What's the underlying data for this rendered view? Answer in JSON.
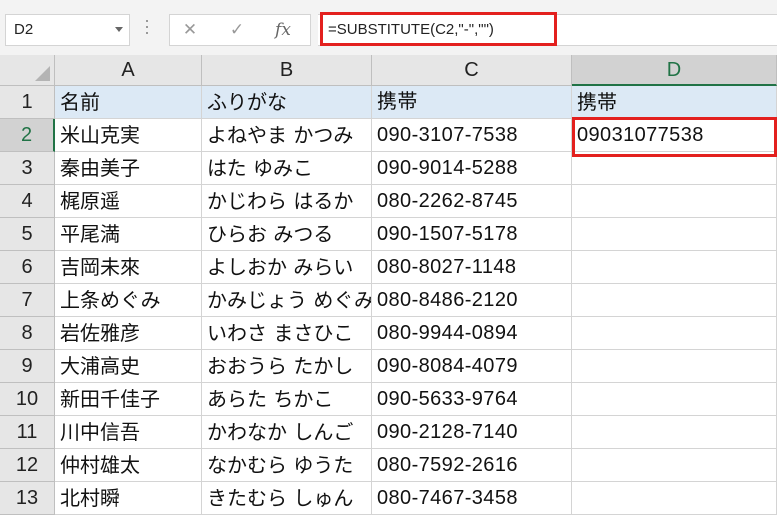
{
  "name_box": {
    "value": "D2"
  },
  "formula_bar": {
    "cancel_glyph": "✕",
    "enter_glyph": "✓",
    "fx_glyph": "fx",
    "formula": "=SUBSTITUTE(C2,\"-\",\"\")"
  },
  "columns": [
    "A",
    "B",
    "C",
    "D"
  ],
  "selected_column": "D",
  "selected_row": "2",
  "rows": [
    {
      "num": "1",
      "a": "名前",
      "b": "ふりがな",
      "c": "携帯",
      "d": "携帯"
    },
    {
      "num": "2",
      "a": "米山克実",
      "b": "よねやま かつみ",
      "c": "090-3107-7538",
      "d": "09031077538"
    },
    {
      "num": "3",
      "a": "秦由美子",
      "b": "はた ゆみこ",
      "c": "090-9014-5288",
      "d": ""
    },
    {
      "num": "4",
      "a": "梶原遥",
      "b": "かじわら はるか",
      "c": "080-2262-8745",
      "d": ""
    },
    {
      "num": "5",
      "a": "平尾満",
      "b": "ひらお みつる",
      "c": "090-1507-5178",
      "d": ""
    },
    {
      "num": "6",
      "a": "吉岡未來",
      "b": "よしおか みらい",
      "c": "080-8027-1148",
      "d": ""
    },
    {
      "num": "7",
      "a": "上条めぐみ",
      "b": "かみじょう めぐみ",
      "c": "080-8486-2120",
      "d": ""
    },
    {
      "num": "8",
      "a": "岩佐雅彦",
      "b": "いわさ まさひこ",
      "c": "080-9944-0894",
      "d": ""
    },
    {
      "num": "9",
      "a": "大浦高史",
      "b": "おおうら たかし",
      "c": "090-8084-4079",
      "d": ""
    },
    {
      "num": "10",
      "a": "新田千佳子",
      "b": "あらた ちかこ",
      "c": "090-5633-9764",
      "d": ""
    },
    {
      "num": "11",
      "a": "川中信吾",
      "b": "かわなか しんご",
      "c": "090-2128-7140",
      "d": ""
    },
    {
      "num": "12",
      "a": "仲村雄太",
      "b": "なかむら ゆうた",
      "c": "080-7592-2616",
      "d": ""
    },
    {
      "num": "13",
      "a": "北村瞬",
      "b": "きたむら しゅん",
      "c": "080-7467-3458",
      "d": ""
    }
  ],
  "colors": {
    "highlight": "#e3201e",
    "header_fill": "#dce9f5",
    "selection": "#217346"
  }
}
